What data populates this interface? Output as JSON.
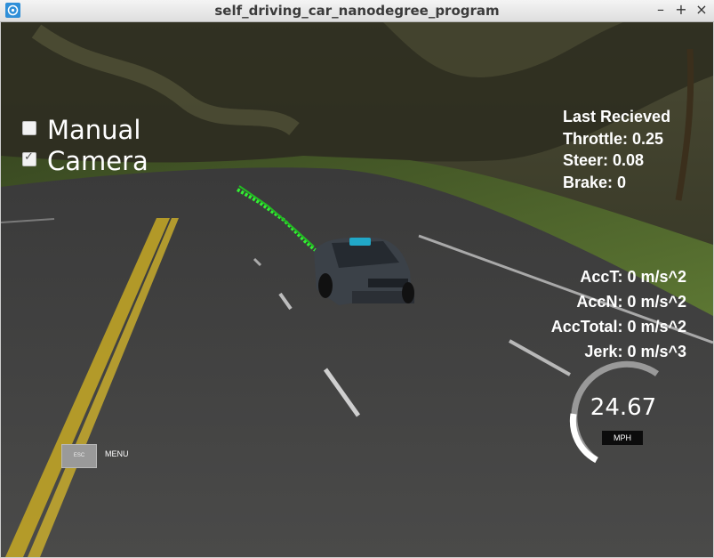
{
  "window": {
    "title": "self_driving_car_nanodegree_program",
    "controls": {
      "minimize": "–",
      "maximize": "+",
      "close": "×"
    }
  },
  "toggles": {
    "manual": {
      "label": "Manual",
      "checked": false
    },
    "camera": {
      "label": "Camera",
      "checked": true,
      "check_glyph": "✓"
    }
  },
  "telemetry": {
    "header": "Last Recieved",
    "throttle": "Throttle: 0.25",
    "steer": "Steer: 0.08",
    "brake": "Brake: 0"
  },
  "acceleration": {
    "acc_t": "AccT: 0 m/s^2",
    "acc_n": "AccN: 0 m/s^2",
    "acc_total": "AccTotal: 0 m/s^2",
    "jerk": "Jerk: 0 m/s^3"
  },
  "speedometer": {
    "value": "24.67",
    "unit": "MPH",
    "fraction": 0.5
  },
  "menu": {
    "esc_label": "ESC",
    "menu_label": "MENU"
  },
  "colors": {
    "path_line": "#33ee33",
    "road": "#424242",
    "lane_yellow": "#d2b21f",
    "car_body": "#3b4148",
    "car_accent": "#21a8c8"
  }
}
